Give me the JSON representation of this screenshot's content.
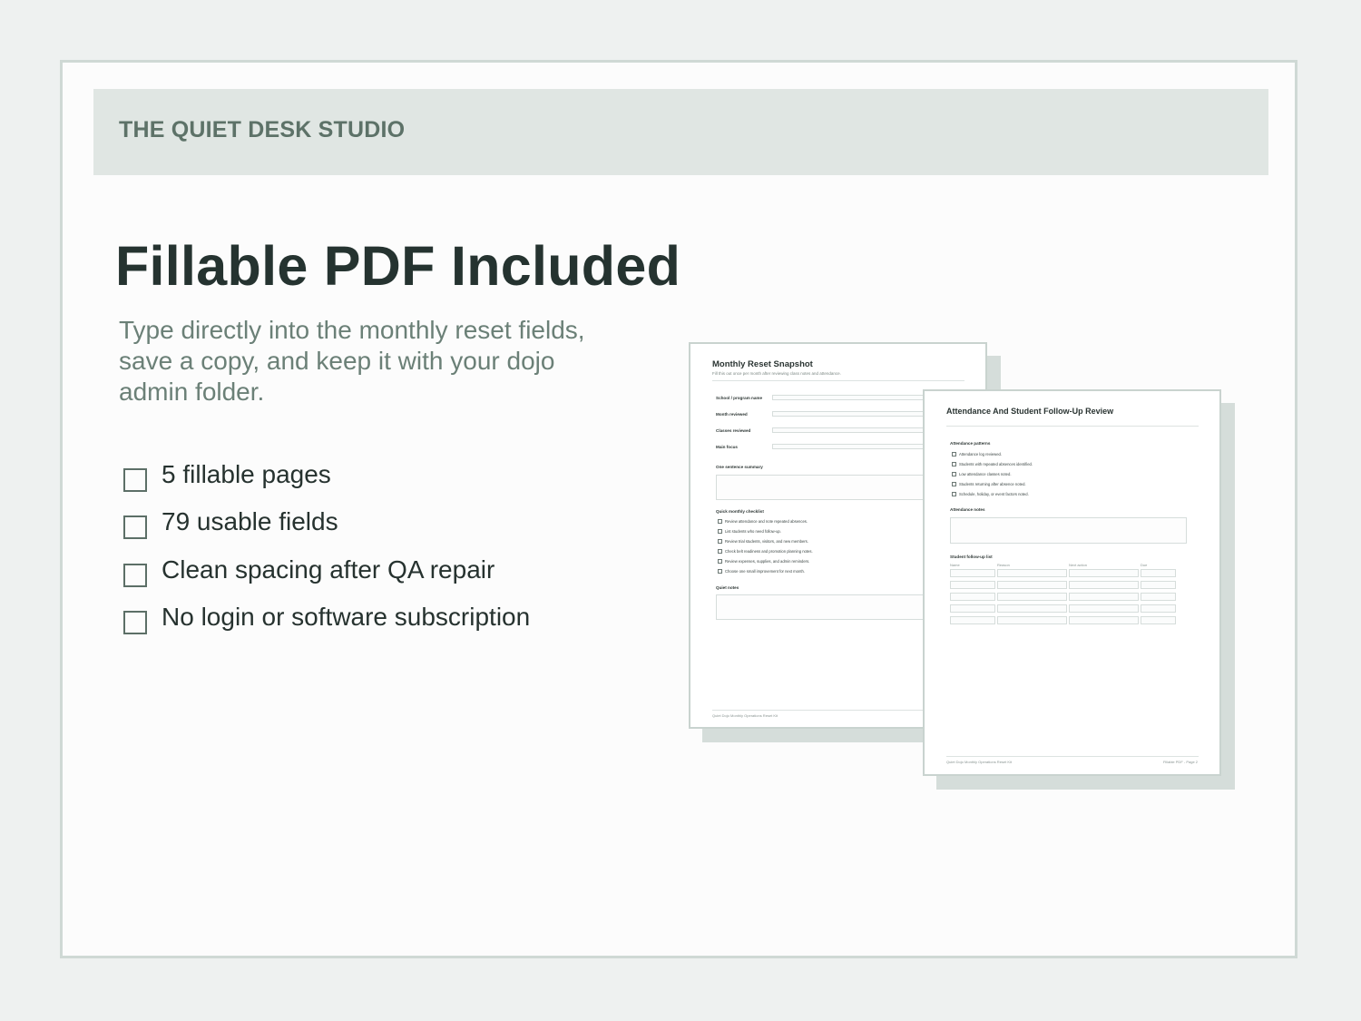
{
  "brand": "THE QUIET DESK STUDIO",
  "title": "Fillable PDF Included",
  "subtitle": "Type directly into the monthly reset fields, save a copy, and keep it with your dojo admin folder.",
  "features": [
    "5 fillable pages",
    "79 usable fields",
    "Clean spacing after QA repair",
    "No login or software subscription"
  ],
  "colors": {
    "background": "#eef1f0",
    "banner": "#e0e6e3",
    "brand_text": "#5d7268",
    "title_text": "#253330",
    "subtitle_text": "#6b8077"
  },
  "page1": {
    "title": "Monthly Reset Snapshot",
    "subtitle": "Fill this out once per month after reviewing class notes and attendance.",
    "fields": [
      "School / program name",
      "Month reviewed",
      "Classes reviewed",
      "Main focus"
    ],
    "summary_label": "One sentence summary",
    "checklist_label": "Quick monthly checklist",
    "checklist": [
      "Review attendance and note repeated absences.",
      "List students who need follow-up.",
      "Review trial students, visitors, and new members.",
      "Check belt readiness and promotion planning notes.",
      "Review expenses, supplies, and admin reminders.",
      "Choose one small improvement for next month."
    ],
    "notes_label": "Quiet notes",
    "footer": "Quiet Dojo Monthly Operations Reset Kit"
  },
  "page2": {
    "title": "Attendance And Student Follow-Up Review",
    "patterns_label": "Attendance patterns",
    "patterns": [
      "Attendance log reviewed.",
      "Students with repeated absences identified.",
      "Low attendance classes noted.",
      "Students returning after absence noted.",
      "Schedule, holiday, or event factors noted."
    ],
    "notes_label": "Attendance notes",
    "followup_label": "Student follow-up list",
    "columns": [
      "Name",
      "Reason",
      "Next action",
      "Due"
    ],
    "footer_left": "Quiet Dojo Monthly Operations Reset Kit",
    "footer_right": "Fillable PDF - Page 2"
  }
}
